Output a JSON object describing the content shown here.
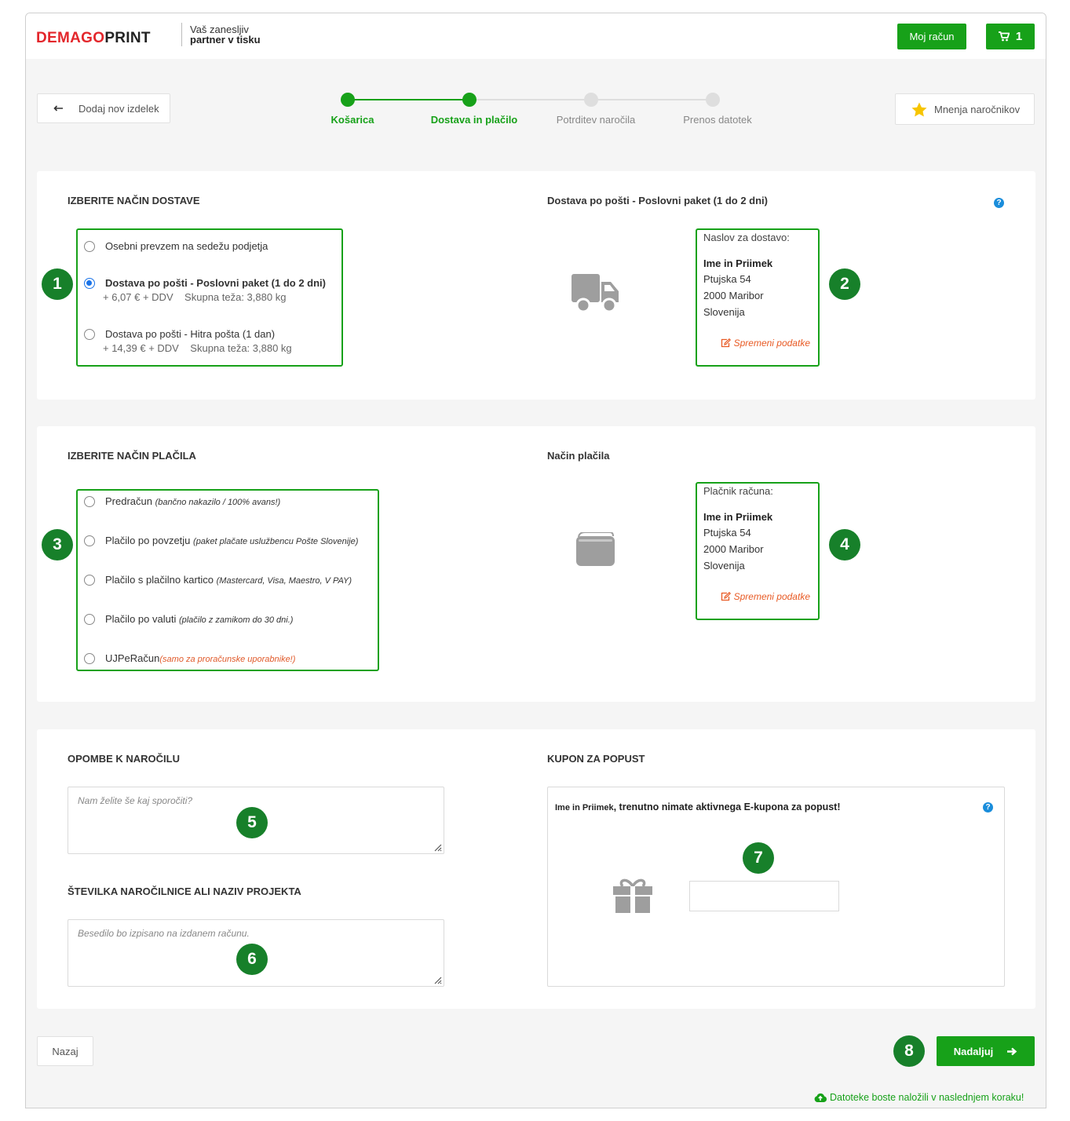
{
  "header": {
    "logo_part1": "DEMAGO",
    "logo_part2": "PRINT",
    "tagline_line1": "Vaš zanesljiv",
    "tagline_line2": "partner v tisku",
    "account_label": "Moj račun",
    "cart_count": "1"
  },
  "nav": {
    "add_product_label": "Dodaj nov izdelek",
    "reviews_label": "Mnenja naročnikov"
  },
  "steps": [
    {
      "label": "Košarica",
      "state": "done"
    },
    {
      "label": "Dostava in plačilo",
      "state": "current"
    },
    {
      "label": "Potrditev naročila",
      "state": "todo"
    },
    {
      "label": "Prenos datotek",
      "state": "todo"
    }
  ],
  "delivery": {
    "title": "IZBERITE NAČIN DOSTAVE",
    "summary_title": "Dostava po pošti - Poslovni paket (1 do 2 dni)",
    "options": [
      {
        "label": "Osebni prevzem na sedežu podjetja",
        "sub": "",
        "selected": false
      },
      {
        "label": "Dostava po pošti - Poslovni paket (1 do 2 dni)",
        "sub": "+ 6,07 € + DDV    Skupna teža: 3,880 kg",
        "selected": true
      },
      {
        "label": "Dostava po pošti - Hitra pošta (1 dan)",
        "sub": "+ 14,39 € + DDV    Skupna teža: 3,880 kg",
        "selected": false
      }
    ],
    "address": {
      "heading": "Naslov za dostavo:",
      "name": "Ime in Priimek",
      "street": "Ptujska 54",
      "city": "2000 Maribor",
      "country": "Slovenija",
      "edit_label": "Spremeni podatke"
    }
  },
  "payment": {
    "title": "IZBERITE NAČIN PLAČILA",
    "summary_title": "Način plačila",
    "options": [
      {
        "label": "Predračun",
        "note": "(bančno nakazilo / 100% avans!)",
        "note_red": false
      },
      {
        "label": "Plačilo po povzetju",
        "note": "(paket plačate uslužbencu Pošte Slovenije)",
        "note_red": false
      },
      {
        "label": "Plačilo s plačilno kartico",
        "note": "(Mastercard, Visa, Maestro, V PAY)",
        "note_red": false
      },
      {
        "label": "Plačilo po valuti",
        "note": "(plačilo z zamikom do 30 dni.)",
        "note_red": false
      },
      {
        "label": "UJPeRačun",
        "note": "(samo za proračunske uporabnike!)",
        "note_red": true
      }
    ],
    "payer": {
      "heading": "Plačnik računa:",
      "name": "Ime in Priimek",
      "street": "Ptujska 54",
      "city": "2000 Maribor",
      "country": "Slovenija",
      "edit_label": "Spremeni podatke"
    }
  },
  "notes": {
    "title": "OPOMBE K NAROČILU",
    "placeholder": "Nam želite še kaj sporočiti?",
    "po_title": "ŠTEVILKA NAROČILNICE ALI NAZIV PROJEKTA",
    "po_placeholder": "Besedilo bo izpisano na izdanem računu."
  },
  "coupon": {
    "title": "KUPON ZA POPUST",
    "user_name": "Ime in Priimek",
    "message": ", trenutno nimate aktivnega E-kupona za popust!",
    "input_value": ""
  },
  "badges": [
    "1",
    "2",
    "3",
    "4",
    "5",
    "6",
    "7",
    "8"
  ],
  "footer": {
    "back_label": "Nazaj",
    "continue_label": "Nadaljuj",
    "upload_note": "Datoteke boste naložili v naslednjem koraku!"
  },
  "colors": {
    "accent_green": "#17a119",
    "badge_green": "#17802a",
    "link_orange": "#e85a24",
    "radio_blue": "#1a73e8"
  }
}
